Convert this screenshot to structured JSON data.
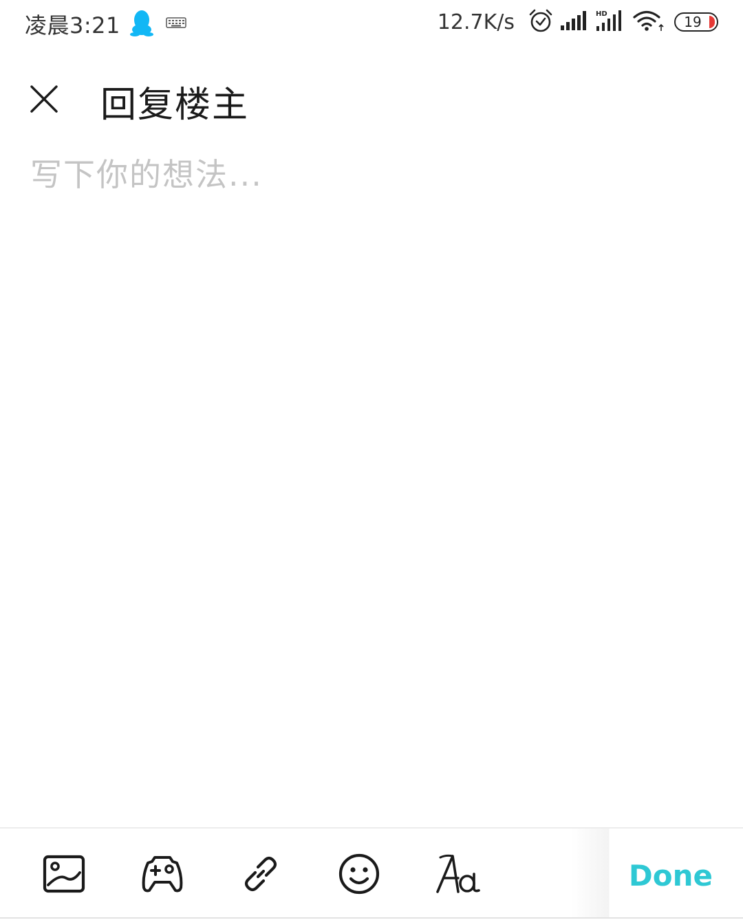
{
  "status_bar": {
    "time": "凌晨3:21",
    "net_speed": "12.7K/s",
    "battery_level": "19",
    "icons": [
      "qq-penguin-icon",
      "keyboard-icon",
      "alarm-icon",
      "signal-icon",
      "hd-signal-icon",
      "wifi-icon",
      "battery-icon"
    ],
    "qq_color": "#12b7f5",
    "battery_low_color": "#e53935"
  },
  "header": {
    "title": "回复楼主",
    "close_icon": "close-icon"
  },
  "editor": {
    "value": "",
    "placeholder": "写下你的想法..."
  },
  "toolbar": {
    "tools": [
      "image-icon",
      "gamepad-icon",
      "link-icon",
      "emoji-icon",
      "font-format-icon"
    ],
    "done_label": "Done",
    "accent_color": "#2ec8d4"
  }
}
